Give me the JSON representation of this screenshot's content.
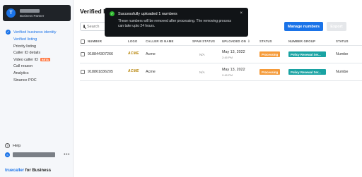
{
  "sidebar": {
    "account": {
      "avatar_letter": "T",
      "role": "Business Partner"
    },
    "section_title": "Verified business identity",
    "items": [
      {
        "label": "Verified listing"
      },
      {
        "label": "Priority listing"
      },
      {
        "label": "Caller ID details"
      },
      {
        "label": "Video caller ID",
        "badge": "BETA"
      },
      {
        "label": "Call reason"
      },
      {
        "label": "Analytics"
      },
      {
        "label": "Sinance POC"
      }
    ],
    "help_label": "Help",
    "user_avatar_letter": "S",
    "more_glyph": "•••",
    "brand": {
      "name": "truecaller",
      "suffix": " for Business"
    }
  },
  "main": {
    "title": "Verified li",
    "search_placeholder": "Search",
    "manage_button": "Manage numbers",
    "export_button": "Export",
    "table": {
      "headers": {
        "number": "NUMBER",
        "logo": "LOGO",
        "caller_id_name": "CALLER ID NAME",
        "spam_status": "SPAM STATUS",
        "uploaded_on": "UPLOADED ON",
        "status": "STATUS",
        "number_group": "NUMBER GROUP",
        "status2": "STATUS"
      },
      "rows": [
        {
          "number": "918844307266",
          "logo": "ACME",
          "caller_id_name": "Acme",
          "spam_status": "N/A",
          "date": "May 13, 2022",
          "time": "2:45 PM",
          "status": "Processing",
          "number_group": "Policy Renewal Ser...",
          "status2": "Numbe"
        },
        {
          "number": "918861836205",
          "logo": "ACME",
          "caller_id_name": "Acme",
          "spam_status": "N/A",
          "date": "May 13, 2022",
          "time": "2:45 PM",
          "status": "Processing",
          "number_group": "Policy Renewal Ser...",
          "status2": "Numbe"
        }
      ]
    }
  },
  "toast": {
    "title": "Successfully uploaded 1 numbers",
    "body": "These numbers will be removed after processing. The removing process can take upto 24 hours.",
    "close_glyph": "×"
  },
  "colors": {
    "accent": "#1a73e8",
    "processing": "#f59b3a",
    "group": "#1aa3a3",
    "toast_bg": "#111417",
    "success": "#2eb82e"
  }
}
